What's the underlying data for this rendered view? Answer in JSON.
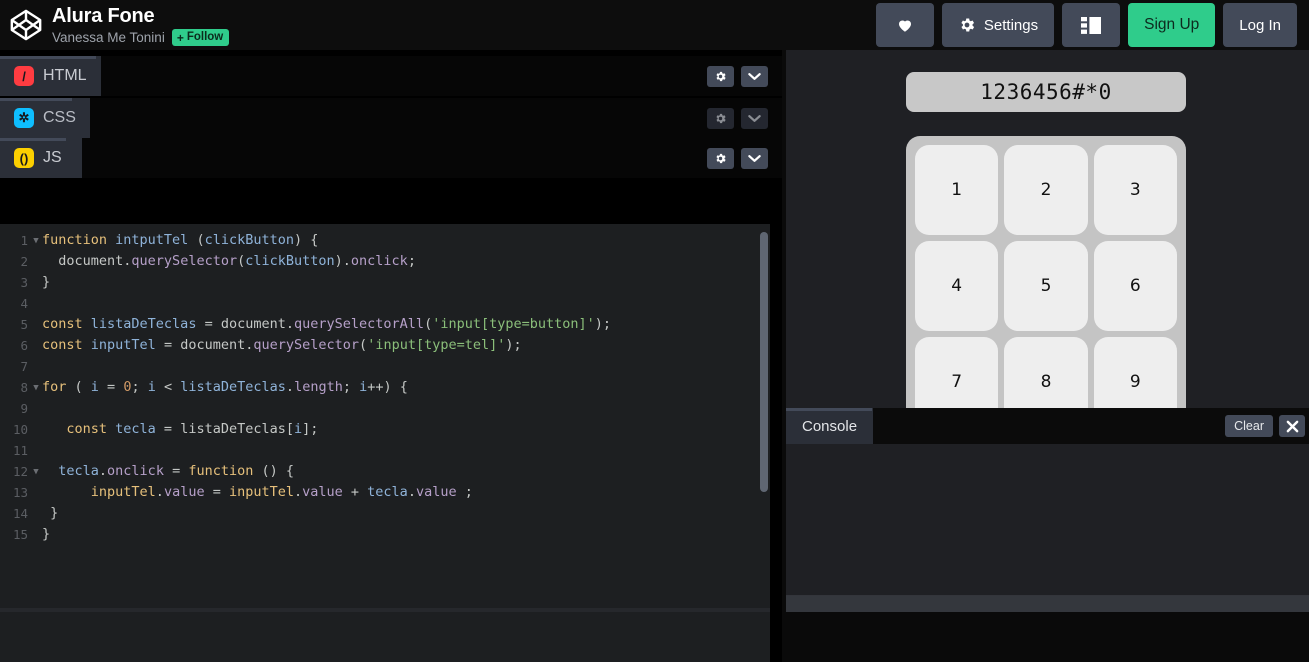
{
  "header": {
    "logo_icon": "codepen-logo-icon",
    "pen_title": "Alura Fone",
    "author": "Vanessa Me Tonini",
    "follow_label": "Follow",
    "follow_plus": "+",
    "actions": {
      "heart_icon": "heart-icon",
      "settings_icon": "gear-icon",
      "settings_label": "Settings",
      "layout_icon": "layout-panel-icon",
      "signup_label": "Sign Up",
      "login_label": "Log In"
    },
    "accent_green": "#2fcc8b",
    "button_gray": "#434a59"
  },
  "editors": [
    {
      "name": "HTML",
      "icon": "html-slash-icon",
      "icon_glyph": "/",
      "icon_color": "#ff3c41",
      "gear_icon": "gear-icon",
      "collapse_icon": "chevron-down-icon"
    },
    {
      "name": "CSS",
      "icon": "css-asterisk-icon",
      "icon_glyph": "✲",
      "icon_color": "#0ebeff",
      "gear_icon": "gear-icon",
      "collapse_icon": "chevron-down-icon"
    },
    {
      "name": "JS",
      "icon": "js-parens-icon",
      "icon_glyph": "()",
      "icon_color": "#fcd000",
      "gear_icon": "gear-icon",
      "collapse_icon": "chevron-down-icon"
    }
  ],
  "code": {
    "language": "JavaScript",
    "lines": [
      {
        "n": "1",
        "fold": true,
        "tokens": [
          {
            "t": "function ",
            "c": "kw"
          },
          {
            "t": "intputTel ",
            "c": "fn"
          },
          {
            "t": "(",
            "c": "pun"
          },
          {
            "t": "clickButton",
            "c": "var"
          },
          {
            "t": ") {",
            "c": "pun"
          }
        ]
      },
      {
        "n": "2",
        "fold": false,
        "tokens": [
          {
            "t": "  document",
            "c": "src"
          },
          {
            "t": ".",
            "c": "pun"
          },
          {
            "t": "querySelector",
            "c": "prop"
          },
          {
            "t": "(",
            "c": "pun"
          },
          {
            "t": "clickButton",
            "c": "var"
          },
          {
            "t": ").",
            "c": "pun"
          },
          {
            "t": "onclick",
            "c": "prop"
          },
          {
            "t": ";",
            "c": "pun"
          }
        ]
      },
      {
        "n": "3",
        "fold": false,
        "tokens": [
          {
            "t": "}",
            "c": "src"
          }
        ]
      },
      {
        "n": "4",
        "fold": false,
        "tokens": [
          {
            "t": "",
            "c": "src"
          }
        ]
      },
      {
        "n": "5",
        "fold": false,
        "tokens": [
          {
            "t": "const ",
            "c": "kw"
          },
          {
            "t": "listaDeTeclas",
            "c": "var"
          },
          {
            "t": " = ",
            "c": "pun"
          },
          {
            "t": "document",
            "c": "src"
          },
          {
            "t": ".",
            "c": "pun"
          },
          {
            "t": "querySelectorAll",
            "c": "prop"
          },
          {
            "t": "(",
            "c": "pun"
          },
          {
            "t": "'input[type=button]'",
            "c": "str"
          },
          {
            "t": ");",
            "c": "pun"
          }
        ]
      },
      {
        "n": "6",
        "fold": false,
        "tokens": [
          {
            "t": "const ",
            "c": "kw"
          },
          {
            "t": "inputTel",
            "c": "var"
          },
          {
            "t": " = ",
            "c": "pun"
          },
          {
            "t": "document",
            "c": "src"
          },
          {
            "t": ".",
            "c": "pun"
          },
          {
            "t": "querySelector",
            "c": "prop"
          },
          {
            "t": "(",
            "c": "pun"
          },
          {
            "t": "'input[type=tel]'",
            "c": "str"
          },
          {
            "t": ");",
            "c": "pun"
          }
        ]
      },
      {
        "n": "7",
        "fold": false,
        "tokens": [
          {
            "t": "",
            "c": "src"
          }
        ]
      },
      {
        "n": "8",
        "fold": true,
        "tokens": [
          {
            "t": "for ",
            "c": "kw"
          },
          {
            "t": "( ",
            "c": "pun"
          },
          {
            "t": "i",
            "c": "var"
          },
          {
            "t": " = ",
            "c": "pun"
          },
          {
            "t": "0",
            "c": "num"
          },
          {
            "t": "; ",
            "c": "pun"
          },
          {
            "t": "i",
            "c": "var"
          },
          {
            "t": " < ",
            "c": "pun"
          },
          {
            "t": "listaDeTeclas",
            "c": "var"
          },
          {
            "t": ".",
            "c": "pun"
          },
          {
            "t": "length",
            "c": "prop"
          },
          {
            "t": "; ",
            "c": "pun"
          },
          {
            "t": "i",
            "c": "var"
          },
          {
            "t": "++) {",
            "c": "pun"
          }
        ]
      },
      {
        "n": "9",
        "fold": false,
        "tokens": [
          {
            "t": "",
            "c": "src"
          }
        ]
      },
      {
        "n": "10",
        "fold": false,
        "tokens": [
          {
            "t": "   const ",
            "c": "kw"
          },
          {
            "t": "tecla",
            "c": "var"
          },
          {
            "t": " = ",
            "c": "pun"
          },
          {
            "t": "listaDeTeclas",
            "c": "src"
          },
          {
            "t": "[",
            "c": "pun"
          },
          {
            "t": "i",
            "c": "var"
          },
          {
            "t": "];",
            "c": "pun"
          }
        ]
      },
      {
        "n": "11",
        "fold": false,
        "tokens": [
          {
            "t": "",
            "c": "src"
          }
        ]
      },
      {
        "n": "12",
        "fold": true,
        "tokens": [
          {
            "t": "  tecla",
            "c": "var"
          },
          {
            "t": ".",
            "c": "pun"
          },
          {
            "t": "onclick",
            "c": "prop"
          },
          {
            "t": " = ",
            "c": "pun"
          },
          {
            "t": "function ",
            "c": "kw"
          },
          {
            "t": "() {",
            "c": "pun"
          }
        ]
      },
      {
        "n": "13",
        "fold": false,
        "tokens": [
          {
            "t": "      inputTel",
            "c": "kw"
          },
          {
            "t": ".",
            "c": "pun"
          },
          {
            "t": "value",
            "c": "prop"
          },
          {
            "t": " = ",
            "c": "pun"
          },
          {
            "t": "inputTel",
            "c": "kw"
          },
          {
            "t": ".",
            "c": "pun"
          },
          {
            "t": "value",
            "c": "prop"
          },
          {
            "t": " + ",
            "c": "pun"
          },
          {
            "t": "tecla",
            "c": "var"
          },
          {
            "t": ".",
            "c": "pun"
          },
          {
            "t": "value",
            "c": "prop"
          },
          {
            "t": " ;",
            "c": "pun"
          }
        ]
      },
      {
        "n": "14",
        "fold": false,
        "tokens": [
          {
            "t": " }",
            "c": "src"
          }
        ]
      },
      {
        "n": "15",
        "fold": false,
        "tokens": [
          {
            "t": "}",
            "c": "src"
          }
        ]
      }
    ]
  },
  "preview": {
    "display_value": "1236456#*0",
    "keys": [
      "1",
      "2",
      "3",
      "4",
      "5",
      "6",
      "7",
      "8",
      "9"
    ]
  },
  "console": {
    "tab_label": "Console",
    "clear_label": "Clear",
    "close_icon": "close-icon",
    "close_glyph": "✕",
    "output": ""
  }
}
